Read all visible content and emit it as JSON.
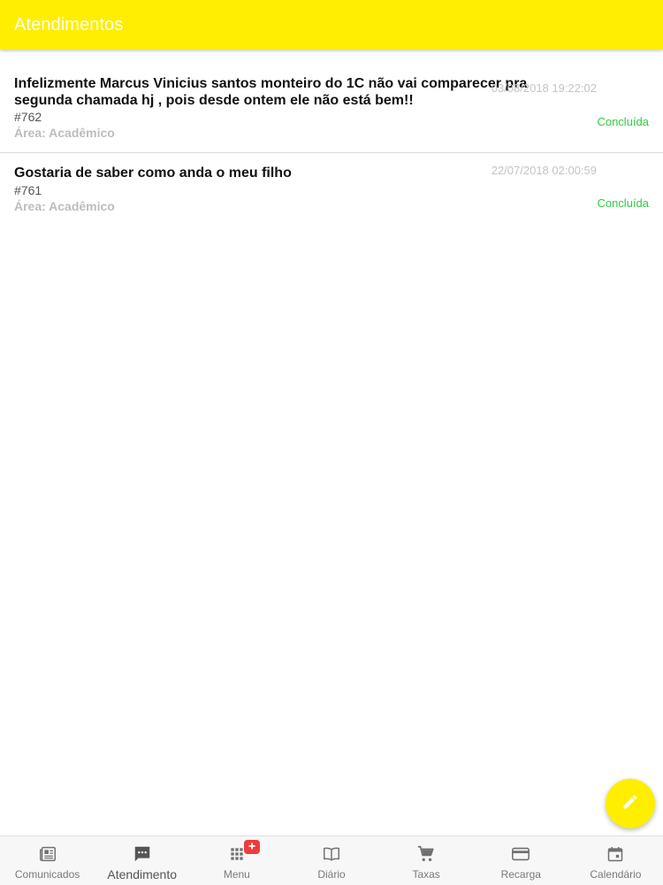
{
  "app_bar": {
    "title": "Atendimentos"
  },
  "tickets": [
    {
      "title": "Infelizmente Marcus Vinicius santos monteiro do 1C não vai comparecer pra segunda chamada hj , pois desde ontem ele não está bem!!",
      "date": "03/08/2018 19:22:02",
      "number": "#762",
      "area": "Área: Acadêmico",
      "status": "Concluída"
    },
    {
      "title": "Gostaria de saber como anda o meu filho",
      "date": "22/07/2018 02:00:59",
      "number": "#761",
      "area": "Área: Acadêmico",
      "status": "Concluída"
    }
  ],
  "fab": {
    "icon": "pencil-icon"
  },
  "bottom_nav": {
    "items": [
      {
        "label": "Comunicados",
        "icon": "newspaper-icon"
      },
      {
        "label": "Atendimento",
        "icon": "chat-icon",
        "active": true
      },
      {
        "label": "Menu",
        "icon": "grid-icon",
        "badge": "+"
      },
      {
        "label": "Diário",
        "icon": "book-icon"
      },
      {
        "label": "Taxas",
        "icon": "cart-icon"
      },
      {
        "label": "Recarga",
        "icon": "credit-card-icon"
      },
      {
        "label": "Calendário",
        "icon": "calendar-icon"
      }
    ]
  },
  "colors": {
    "accent": "#ffee00",
    "status_done": "#2ecc40",
    "badge": "#ef3b3b"
  }
}
